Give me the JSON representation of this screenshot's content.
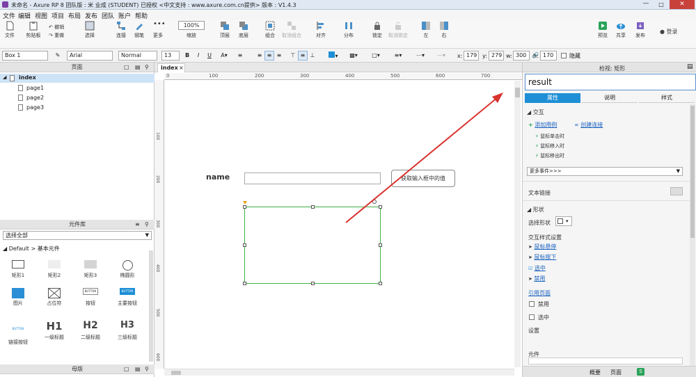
{
  "title_bar": {
    "text": "未命名 - Axure RP 8 团队版 : 米 业成 (STUDENT) 已授权    <中文支持 : www.axure.com.cn提供> 版本 : V1.4.3"
  },
  "menu": [
    "文件",
    "编辑",
    "视图",
    "项目",
    "布局",
    "发布",
    "团队",
    "账户",
    "帮助"
  ],
  "toolbar": {
    "file": "文件",
    "clipboard": "剪贴板",
    "undo": "撤销",
    "redo": "重做",
    "select": "选择",
    "connect": "连接",
    "pen": "钢笔",
    "more": "更多",
    "zoom_value": "100%",
    "zoom": "缩放",
    "top": "顶层",
    "bottom": "底层",
    "group": "组合",
    "ungroup": "取消组合",
    "align": "对齐",
    "distribute": "分布",
    "lock": "锁定",
    "unlock": "取消锁定",
    "left": "左",
    "right": "右",
    "preview": "预览",
    "share": "共享",
    "publish": "发布",
    "login": "登录"
  },
  "format_bar": {
    "shape_name": "Box 1",
    "font": "Arial",
    "style": "Normal",
    "size": "13",
    "x_label": "x:",
    "x": "179",
    "y_label": "y:",
    "y": "279",
    "w_label": "w:",
    "w": "300",
    "h_label": "h:",
    "h": "170",
    "hidden": "隐藏"
  },
  "pages_panel": {
    "title": "页面",
    "root": "index",
    "pages": [
      "page1",
      "page2",
      "page3"
    ]
  },
  "library_panel": {
    "title": "元件库",
    "dropdown": "选择全部",
    "category": "Default > 基本元件",
    "widgets": [
      "矩形1",
      "矩形2",
      "矩形3",
      "椭圆形",
      "图片",
      "占位符",
      "按钮",
      "主要按钮",
      "链接按钮",
      "一级标题",
      "二级标题",
      "三级标题"
    ],
    "btn_text": "BUTTON",
    "h1": "H1",
    "h2": "H2",
    "h3": "H3"
  },
  "masters_panel": {
    "title": "母版"
  },
  "canvas": {
    "tab": "index",
    "ruler_h": [
      "0",
      "100",
      "200",
      "300",
      "400",
      "500",
      "600",
      "700"
    ],
    "ruler_v": [
      "100",
      "200",
      "300",
      "400",
      "500",
      "600"
    ],
    "name_label": "name",
    "button_label": "获取输入框中的值"
  },
  "inspector": {
    "title": "检视: 矩形",
    "shape_name": "result",
    "tabs": [
      "属性",
      "说明",
      "样式"
    ],
    "interaction_header": "交互",
    "add_case": "添加用例",
    "create_link": "创建连接",
    "events": [
      "鼠标单击时",
      "鼠标移入时",
      "鼠标移出时"
    ],
    "more_events": "更多事件>>>",
    "text_link": "文本链接",
    "shape_header": "形状",
    "select_shape": "选择形状",
    "interaction_styles": "交互样式设置",
    "styles": [
      "鼠标悬停",
      "鼠标按下",
      "选中",
      "禁用"
    ],
    "reference_page": "引用页面",
    "disabled": "禁用",
    "selected": "选中",
    "set_label": "设置",
    "component_label": "元件",
    "footer_left": "概要",
    "footer_right": "页面"
  },
  "colors": {
    "accent": "#1e8fd6",
    "arrow": "#d9332f",
    "selection": "#3cb043"
  }
}
